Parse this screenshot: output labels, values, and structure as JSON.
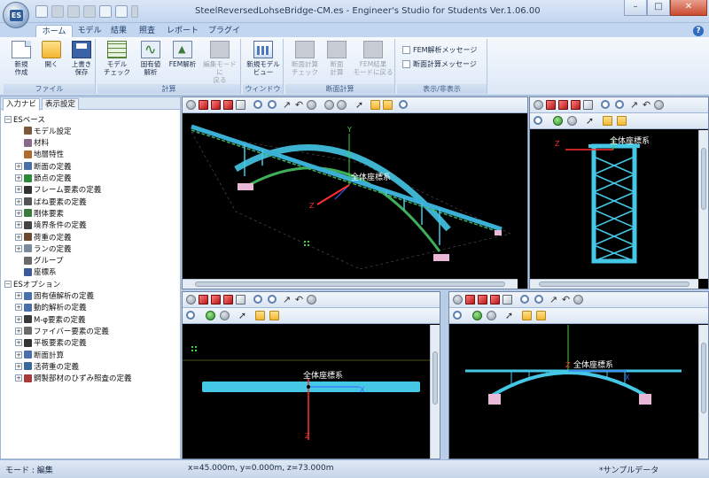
{
  "title": "SteelReversedLohseBridge-CM.es - Engineer's Studio for Students Ver.1.06.00",
  "app_badge": "ES",
  "ribbon_tabs": [
    "ホーム",
    "モデル",
    "結果",
    "照査",
    "レポート",
    "プラグイン"
  ],
  "ribbon_groups": {
    "file": {
      "label": "ファイル",
      "buttons": [
        "新規\n作成",
        "開く",
        "上書き\n保存"
      ]
    },
    "calc": {
      "label": "計算",
      "buttons": [
        "モデル\nチェック",
        "固有値\n解析",
        "FEM解析",
        "編集モードに\n戻る"
      ]
    },
    "window": {
      "label": "ウィンドウ",
      "buttons": [
        "新規モデル\nビュー"
      ]
    },
    "section_calc": {
      "label": "断面計算",
      "buttons": [
        "断面計算\nチェック",
        "断面\n計算",
        "FEM結果\nモードに戻る"
      ]
    },
    "display": {
      "label": "表示/非表示",
      "checks": [
        "FEM解析メッセージ",
        "断面計算メッセージ"
      ]
    }
  },
  "left_tabs": [
    "入力ナビ",
    "表示設定"
  ],
  "tree": [
    {
      "level": 0,
      "exp": "−",
      "label": "ESベース",
      "color": ""
    },
    {
      "level": 1,
      "exp": "",
      "label": "モデル設定",
      "color": "#7a5a3a"
    },
    {
      "level": 1,
      "exp": "",
      "label": "材料",
      "color": "#8a6a8a"
    },
    {
      "level": 1,
      "exp": "",
      "label": "地層特性",
      "color": "#b06a30"
    },
    {
      "level": 1,
      "exp": "+",
      "label": "断面の定義",
      "color": "#4a6ea8"
    },
    {
      "level": 1,
      "exp": "+",
      "label": "節点の定義",
      "color": "#2a8a3a"
    },
    {
      "level": 1,
      "exp": "+",
      "label": "フレーム要素の定義",
      "color": "#333333"
    },
    {
      "level": 1,
      "exp": "+",
      "label": "ばね要素の定義",
      "color": "#555555"
    },
    {
      "level": 1,
      "exp": "+",
      "label": "剛体要素",
      "color": "#3a7a3a"
    },
    {
      "level": 1,
      "exp": "+",
      "label": "境界条件の定義",
      "color": "#444444"
    },
    {
      "level": 1,
      "exp": "+",
      "label": "荷重の定義",
      "color": "#6a4a2a"
    },
    {
      "level": 1,
      "exp": "+",
      "label": "ランの定義",
      "color": "#7a8a9a"
    },
    {
      "level": 1,
      "exp": "",
      "label": "グループ",
      "color": "#6a6a6a"
    },
    {
      "level": 1,
      "exp": "",
      "label": "座標系",
      "color": "#3a5a9a"
    },
    {
      "level": 0,
      "exp": "−",
      "label": "ESオプション",
      "color": ""
    },
    {
      "level": 1,
      "exp": "+",
      "label": "固有値解析の定義",
      "color": "#4a6ea8"
    },
    {
      "level": 1,
      "exp": "+",
      "label": "動的解析の定義",
      "color": "#4a6ea8"
    },
    {
      "level": 1,
      "exp": "+",
      "label": "M-φ要素の定義",
      "color": "#3a3a3a"
    },
    {
      "level": 1,
      "exp": "+",
      "label": "ファイバー要素の定義",
      "color": "#6a6a6a"
    },
    {
      "level": 1,
      "exp": "+",
      "label": "平板要素の定義",
      "color": "#333333"
    },
    {
      "level": 1,
      "exp": "+",
      "label": "断面計算",
      "color": "#4a6ea8"
    },
    {
      "level": 1,
      "exp": "+",
      "label": "活荷重の定義",
      "color": "#3a6a9a"
    },
    {
      "level": 1,
      "exp": "+",
      "label": "鋼製部材のひずみ照査の定義",
      "color": "#a83a3a"
    }
  ],
  "viewport_labels": {
    "coord_system": "全体座標系",
    "axis_x": "X",
    "axis_y": "Y",
    "axis_z": "Z"
  },
  "status": {
    "mode": "モード : 編集",
    "coords": "x=45.000m, y=0.000m, z=73.000m",
    "sample": "*サンプルデータ"
  },
  "colors": {
    "bridge_main": "#45c7e6",
    "bridge_deck": "#3ab0d6",
    "bridge_bracing": "#3fae5a",
    "support": "#e9b8d6",
    "axis_red": "#ff3030",
    "axis_green": "#40d040",
    "axis_blue": "#4060ff"
  }
}
